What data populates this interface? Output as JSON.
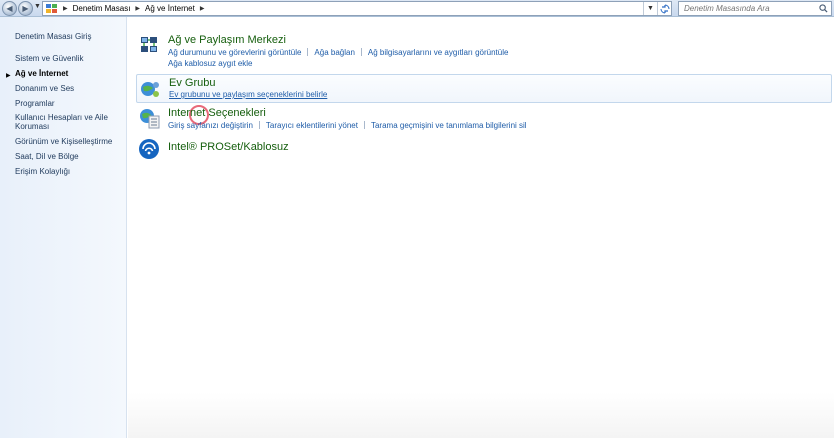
{
  "address_bar": {
    "crumbs": [
      "Denetim Masası",
      "Ağ ve İnternet"
    ],
    "search_placeholder": "Denetim Masasında Ara"
  },
  "icons": {
    "back": "back-arrow-icon",
    "forward": "forward-arrow-icon",
    "control_panel": "control-panel-icon",
    "refresh": "refresh-icon",
    "search": "search-icon"
  },
  "sidebar": {
    "items": [
      {
        "label": "Denetim Masası Giriş",
        "active": false
      },
      {
        "label": "Sistem ve Güvenlik",
        "active": false
      },
      {
        "label": "Ağ ve İnternet",
        "active": true
      },
      {
        "label": "Donanım ve Ses",
        "active": false
      },
      {
        "label": "Programlar",
        "active": false
      },
      {
        "label": "Kullanıcı Hesapları ve Aile",
        "active": false
      },
      {
        "label": "Koruması",
        "active": false
      },
      {
        "label": "Görünüm ve Kişiselleştirme",
        "active": false
      },
      {
        "label": "Saat, Dil ve Bölge",
        "active": false
      },
      {
        "label": "Erişim Kolaylığı",
        "active": false
      }
    ]
  },
  "categories": [
    {
      "title": "Ağ ve Paylaşım Merkezi",
      "icon": "network-center-icon",
      "links": [
        "Ağ durumunu ve görevlerini görüntüle",
        "Ağa bağlan",
        "Ağ bilgisayarlarını ve aygıtları görüntüle",
        "Ağa kablosuz aygıt ekle"
      ]
    },
    {
      "title": "Ev Grubu",
      "icon": "homegroup-icon",
      "links": [
        "Ev grubunu ve paylaşım seçeneklerini belirle"
      ]
    },
    {
      "title": "Internet Seçenekleri",
      "icon": "internet-options-icon",
      "links": [
        "Giriş sayfanızı değiştirin",
        "Tarayıcı eklentilerini yönet",
        "Tarama geçmişini ve tanımlama bilgilerini sil"
      ]
    },
    {
      "title": "Intel® PROSet/Kablosuz",
      "icon": "wireless-icon",
      "links": []
    }
  ],
  "colors": {
    "category_title": "#155e0d",
    "link": "#1e5ca8",
    "sidebar_bg": "#e8f0fa",
    "cursor_ring": "#e86a7a"
  }
}
